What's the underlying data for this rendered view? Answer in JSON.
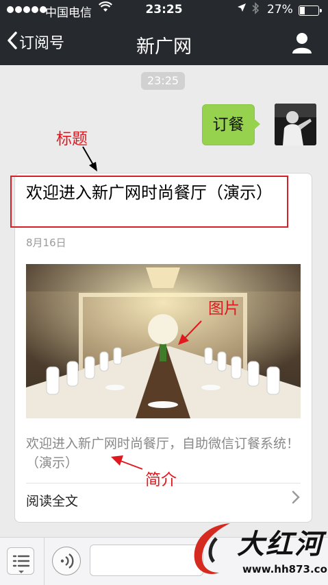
{
  "status_bar": {
    "carrier": "中国电信",
    "time": "23:25",
    "battery": "27%",
    "battery_level": 0.27,
    "icons": [
      "signal-dots-icon",
      "wifi-icon",
      "location-arrow-icon",
      "bluetooth-icon",
      "battery-icon"
    ]
  },
  "nav": {
    "back_label": "订阅号",
    "title": "新广网",
    "profile_icon": "person-icon"
  },
  "chat": {
    "timestamp": "23:25",
    "message": "订餐",
    "card": {
      "title": "欢迎进入新广网时尚餐厅（演示）",
      "date": "8月16日",
      "summary": "欢迎进入新广网时尚餐厅，自助微信订餐系统！（演示）",
      "read_more": "阅读全文"
    }
  },
  "annotations": {
    "title_label": "标题",
    "image_label": "图片",
    "summary_label": "简介",
    "color": "#e0191f"
  },
  "input_bar": {
    "icons": [
      "menu-list-icon",
      "voice-icon"
    ]
  },
  "watermark": {
    "name": "大红河",
    "url": "www.hh873.com"
  },
  "colors": {
    "nav_bg": "#262a2f",
    "bubble": "#97d24f",
    "chat_bg": "#ebebeb"
  }
}
